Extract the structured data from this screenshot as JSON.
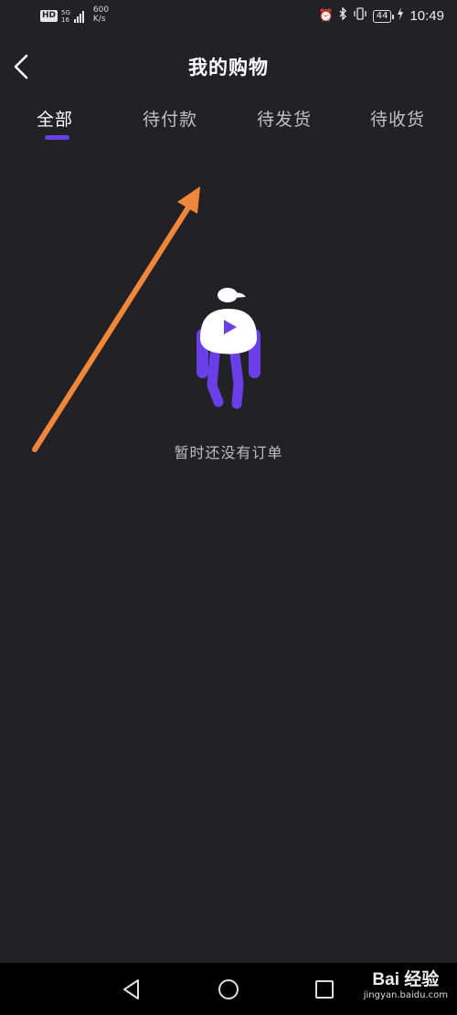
{
  "status_bar": {
    "hd": "HD",
    "network_type": "5G",
    "network_sub": "16",
    "net_speed_value": "600",
    "net_speed_unit": "K/s",
    "battery": "44",
    "time": "10:49"
  },
  "header": {
    "title": "我的购物"
  },
  "tabs": [
    {
      "label": "全部",
      "active": true
    },
    {
      "label": "待付款",
      "active": false
    },
    {
      "label": "待发货",
      "active": false
    },
    {
      "label": "待收货",
      "active": false
    }
  ],
  "empty_state": {
    "message": "暂时还没有订单"
  },
  "watermark": {
    "main": "Bai 经验",
    "sub": "jingyan.baidu.com"
  },
  "colors": {
    "background": "#222126",
    "accent": "#6a3fe8",
    "annotation_arrow": "#f0873a",
    "nav_bar": "#000000"
  }
}
